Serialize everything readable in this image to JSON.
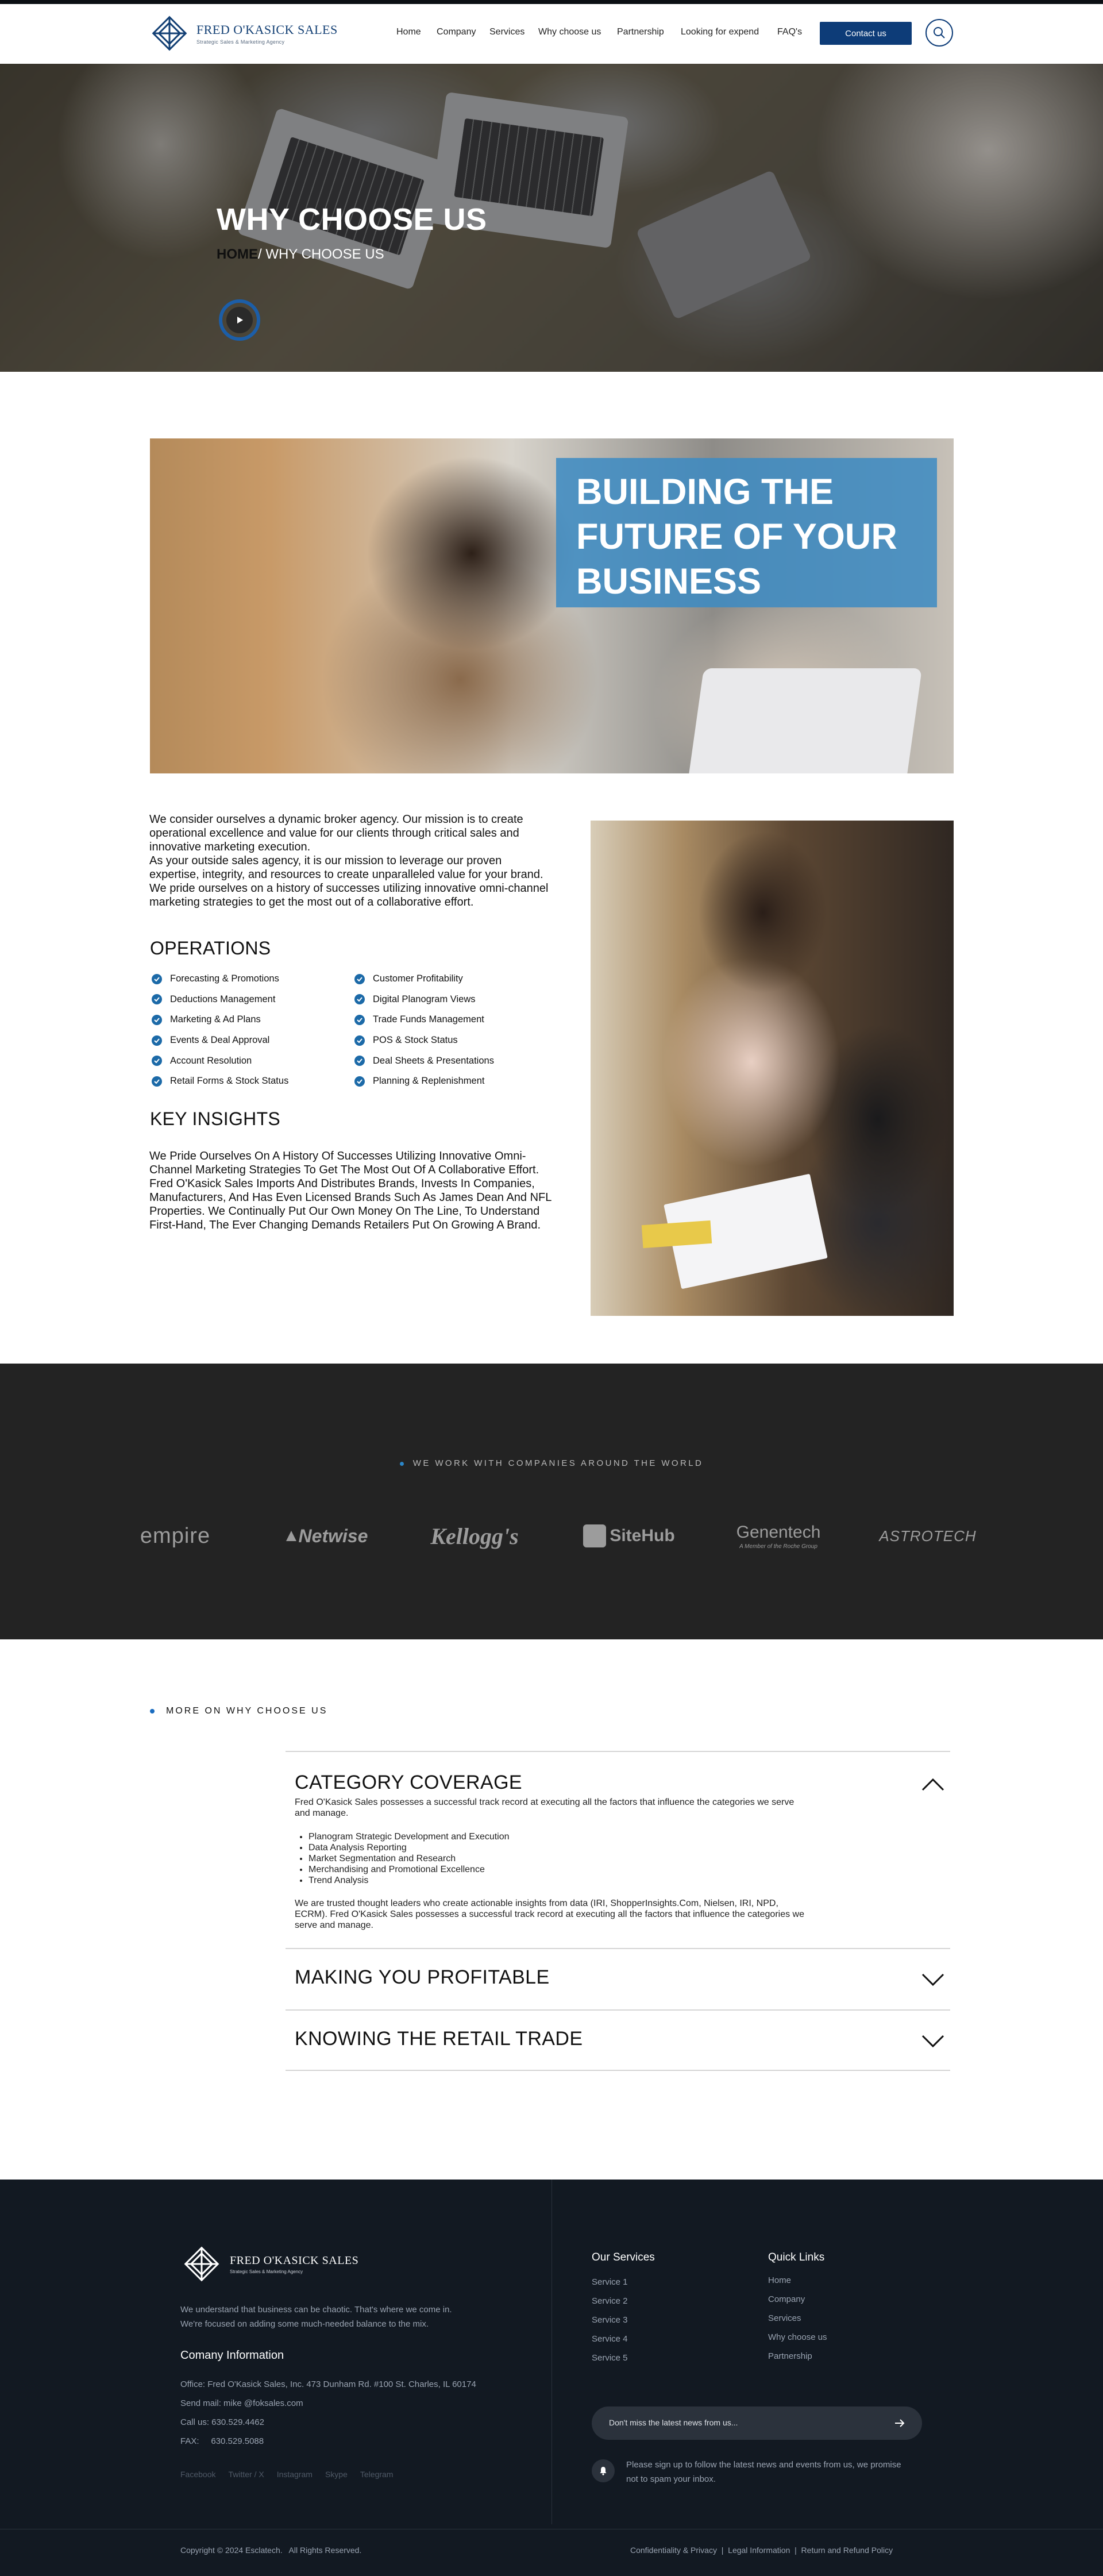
{
  "header": {
    "logo_title": "FRED O'KASICK SALES",
    "logo_sub": "Strategic Sales & Marketing Agency",
    "nav": [
      "Home",
      "Company",
      "Services",
      "Why choose us",
      "Partnership",
      "Looking for expend",
      "FAQ's"
    ],
    "contact_label": "Contact us"
  },
  "hero": {
    "title": "WHY CHOOSE US",
    "crumb_home": "HOME",
    "crumb_sep": "/",
    "crumb_current": "WHY CHOOSE US"
  },
  "banner": {
    "line1": "BUILDING THE",
    "line2": "FUTURE OF YOUR",
    "line3": "BUSINESS"
  },
  "intro": {
    "p1": "We consider ourselves a dynamic broker agency. Our mission is to create operational excellence and value for our clients through critical sales and innovative marketing execution.",
    "p2": "As your outside sales agency, it is our mission to leverage our proven expertise, integrity, and resources to create unparalleled value for your brand. We pride ourselves on a history of successes utilizing innovative omni-channel marketing strategies to get the most out of a collaborative effort."
  },
  "operations": {
    "title": "OPERATIONS",
    "left": [
      "Forecasting & Promotions",
      "Deductions Management",
      "Marketing & Ad Plans",
      "Events & Deal Approval",
      "Account Resolution",
      "Retail Forms & Stock Status"
    ],
    "right": [
      "Customer Profitability",
      "Digital Planogram Views",
      "Trade Funds Management",
      "POS & Stock Status",
      "Deal Sheets & Presentations",
      "Planning & Replenishment"
    ]
  },
  "insights": {
    "title": "KEY INSIGHTS",
    "text": "We Pride Ourselves On A History Of Successes Utilizing Innovative Omni-Channel Marketing Strategies To Get The Most Out Of A Collaborative Effort.  Fred O'Kasick Sales Imports And Distributes Brands, Invests In Companies, Manufacturers, And Has Even Licensed Brands Such As James Dean And NFL Properties. We Continually Put Our Own Money On The Line, To Understand First-Hand, The Ever Changing Demands Retailers Put On Growing A Brand."
  },
  "clients": {
    "label": "WE WORK WITH COMPANIES AROUND THE WORLD",
    "logos": [
      "empire",
      "Netwise",
      "Kellogg's",
      "SiteHub",
      "Genentech",
      "ASTROTECH"
    ],
    "genentech_sub": "A Member of the Roche Group"
  },
  "more": {
    "label": "MORE ON WHY CHOOSE US",
    "items": [
      {
        "title": "CATEGORY COVERAGE",
        "p1": "Fred O'Kasick Sales possesses a successful track record at executing all the factors that influence the categories we serve and manage.",
        "bullets": [
          "Planogram Strategic Development and Execution",
          "Data Analysis Reporting",
          "Market Segmentation and Research",
          "Merchandising and Promotional Excellence",
          "Trend Analysis"
        ],
        "p2": "We are trusted thought leaders who create actionable insights from data (IRI, ShopperInsights.Com, Nielsen, IRI, NPD, ECRM). Fred O'Kasick Sales possesses a successful track record at executing all the factors that influence the categories we serve and manage."
      },
      {
        "title": "MAKING YOU PROFITABLE"
      },
      {
        "title": "KNOWING THE RETAIL TRADE"
      }
    ]
  },
  "footer": {
    "logo_title": "FRED O'KASICK SALES",
    "logo_sub": "Strategic Sales & Marketing Agency",
    "about_1": "We understand that business can be chaotic. That's where we come in.",
    "about_2": "We're focused on adding some much-needed balance to the mix.",
    "company_title": "Comany Information",
    "office": "Office: Fred O'Kasick Sales, Inc. 473 Dunham Rd. #100 St. Charles, IL 60174",
    "email": "Send mail: mike @foksales.com",
    "phone": "Call us: 630.529.4462",
    "fax": "FAX:     630.529.5088",
    "social": [
      "Facebook",
      "Twitter / X",
      "Instagram",
      "Skype",
      "Telegram"
    ],
    "services_title": "Our Services",
    "services": [
      "Service 1",
      "Service 2",
      "Service 3",
      "Service 4",
      "Service 5"
    ],
    "quick_title": "Quick Links",
    "quick": [
      "Home",
      "Company",
      "Services",
      "Why choose us",
      "Partnership"
    ],
    "news_placeholder": "Don't miss the latest news from us...",
    "news_note": "Please sign up to follow the latest news and events from us, we promise not to spam your inbox.",
    "copyright": "Copyright © 2024 Esclatech.   All Rights Reserved.",
    "legal": [
      "Confidentiality & Privacy",
      "Legal Information",
      "Return and Refund Policy"
    ]
  },
  "colors": {
    "brand_navy": "#0d3c78",
    "accent_blue": "#1c6aa8",
    "banner_blue": "#3c8ac2",
    "dark_band": "#232323",
    "footer_bg": "#121922"
  }
}
